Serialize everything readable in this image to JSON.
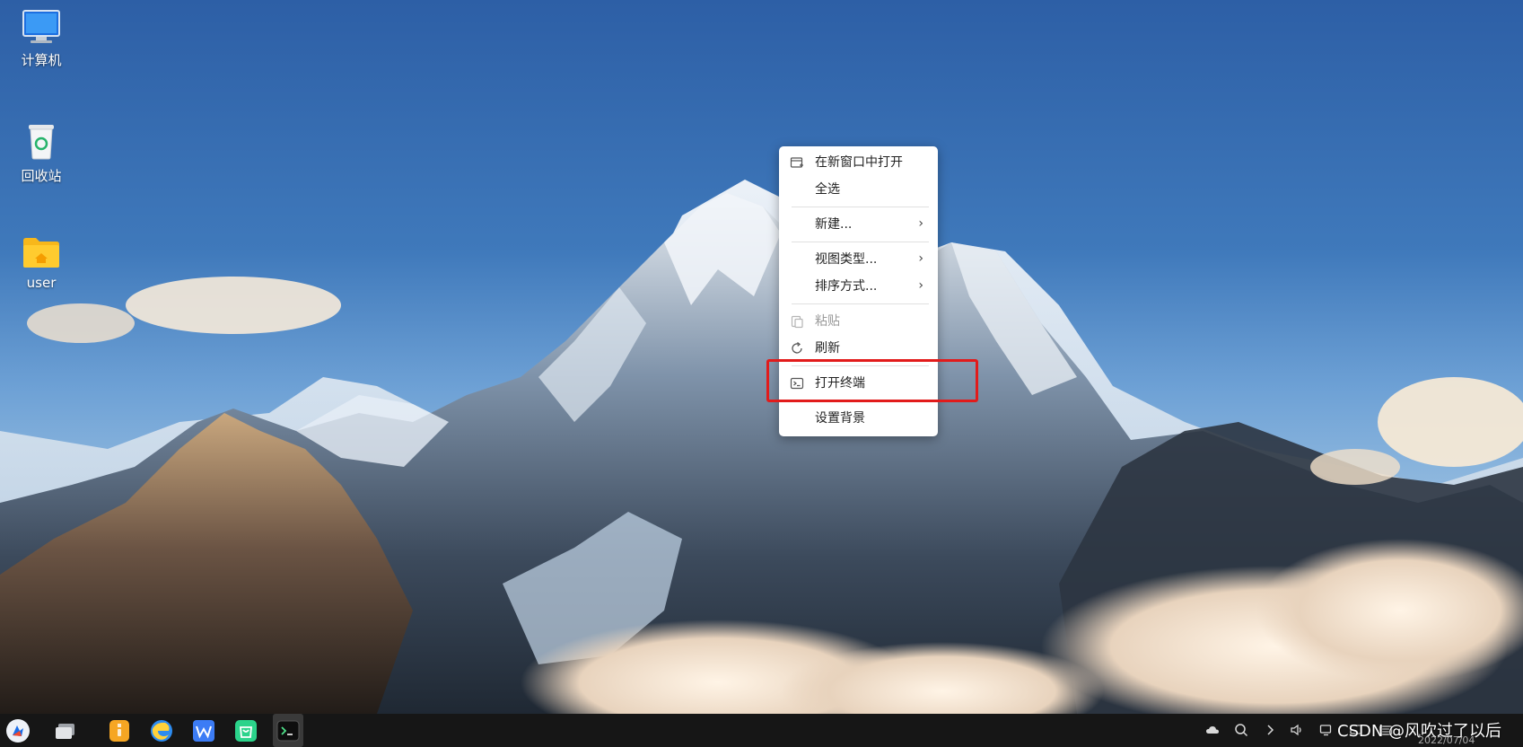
{
  "desktop": {
    "icons": [
      {
        "label": "计算机",
        "icon": "computer-icon"
      },
      {
        "label": "回收站",
        "icon": "trash-icon"
      },
      {
        "label": "user",
        "icon": "home-folder-icon"
      }
    ]
  },
  "context_menu": {
    "items": [
      {
        "label": "在新窗口中打开",
        "icon": "new-window-icon",
        "submenu": false,
        "enabled": true
      },
      {
        "label": "全选",
        "icon": null,
        "submenu": false,
        "enabled": true
      },
      {
        "label": "新建...",
        "icon": null,
        "submenu": true,
        "enabled": true
      },
      {
        "label": "视图类型...",
        "icon": null,
        "submenu": true,
        "enabled": true
      },
      {
        "label": "排序方式...",
        "icon": null,
        "submenu": true,
        "enabled": true
      },
      {
        "label": "粘贴",
        "icon": "paste-icon",
        "submenu": false,
        "enabled": false
      },
      {
        "label": "刷新",
        "icon": "refresh-icon",
        "submenu": false,
        "enabled": true
      },
      {
        "label": "打开终端",
        "icon": "terminal-icon",
        "submenu": false,
        "enabled": true,
        "highlighted": true
      },
      {
        "label": "设置背景",
        "icon": null,
        "submenu": false,
        "enabled": true
      }
    ],
    "submenu_arrow": "›"
  },
  "taskbar": {
    "apps": [
      {
        "name": "start-menu",
        "icon": "start-menu-icon",
        "color": "#e8eef8"
      },
      {
        "name": "multitask-view",
        "icon": "multitask-view-icon",
        "color": "#d9d9d9"
      },
      {
        "name": "file-manager",
        "icon": "file-manager-icon",
        "color": "#f5a623"
      },
      {
        "name": "browser",
        "icon": "browser-icon",
        "color": "#2d8cf0"
      },
      {
        "name": "wps",
        "icon": "wps-icon",
        "color": "#3c7cf5"
      },
      {
        "name": "software-store",
        "icon": "software-store-icon",
        "color": "#2bd38b"
      },
      {
        "name": "terminal",
        "icon": "terminal-app-icon",
        "color": "#2a2a2a",
        "active": true
      }
    ],
    "tray": [
      "cloud-icon",
      "search-icon",
      "chevron-right-icon",
      "volume-icon",
      "network-icon",
      "notification-icon",
      "keyboard-icon"
    ],
    "date": "2022/07/04",
    "watermark": "CSDN @风吹过了以后"
  },
  "colors": {
    "highlight": "#e21b1b",
    "taskbar_bg": "#161616"
  }
}
